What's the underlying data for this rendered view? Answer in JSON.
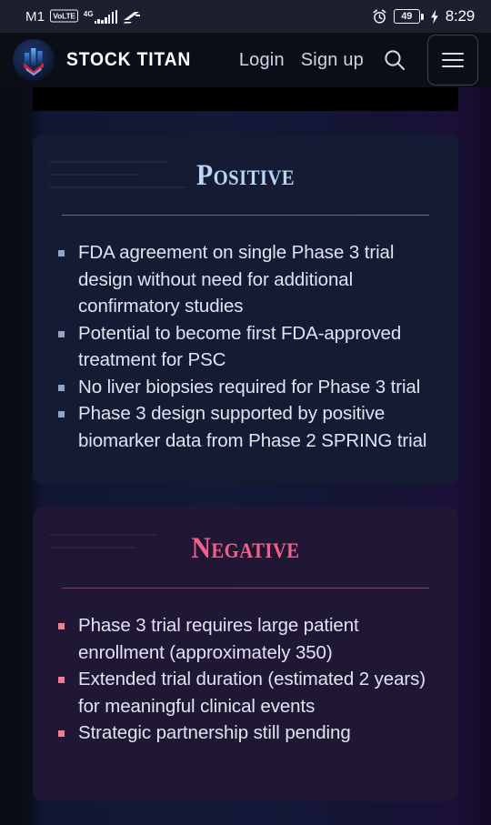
{
  "status_bar": {
    "carrier": "M1",
    "volte_badge": "VoLTE",
    "network_type": "4G",
    "signal_icon": "signal-bars-icon",
    "data_icon": "mobile-data-arrows-icon",
    "alarm_icon": "alarm-clock-icon",
    "battery_level": "49",
    "charging_icon": "charging-bolt-icon",
    "time": "8:29"
  },
  "header": {
    "logo_icon": "stock-titan-logo-icon",
    "brand": "STOCK TITAN",
    "login_label": "Login",
    "signup_label": "Sign up",
    "search_icon": "search-icon",
    "menu_icon": "hamburger-menu-icon"
  },
  "cards": {
    "positive": {
      "title": "Positive",
      "accent": "#b9d6f7",
      "background": "#141b33",
      "bullet_color": "#8fa6c8",
      "items": [
        "FDA agreement on single Phase 3 trial design without need for additional confirmatory studies",
        "Potential to become first FDA-approved treatment for PSC",
        "No liver biopsies required for Phase 3 trial",
        "Phase 3 design supported by positive biomarker data from Phase 2 SPRING trial"
      ]
    },
    "negative": {
      "title": "Negative",
      "accent": "#f4608c",
      "background": "#1f1733",
      "bullet_color": "#ef7e95",
      "items": [
        "Phase 3 trial requires large patient enrollment (approximately 350)",
        "Extended trial duration (estimated 2 years) for meaningful clinical events",
        "Strategic partnership still pending"
      ]
    }
  }
}
